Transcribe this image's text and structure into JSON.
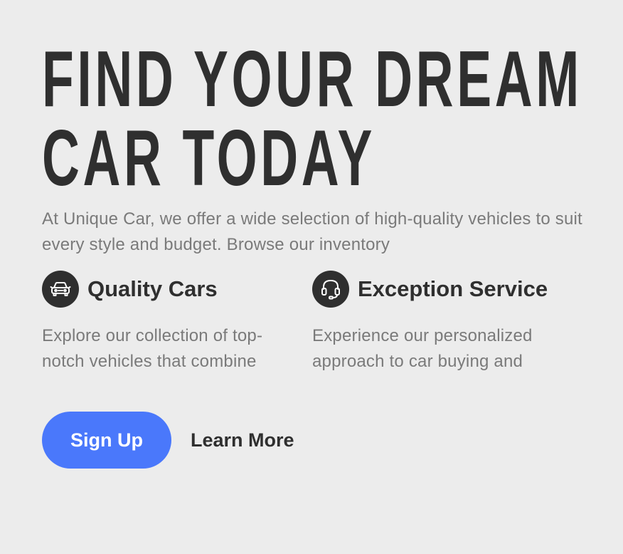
{
  "hero": {
    "headline_line1": "FIND YOUR DREAM",
    "headline_line2": "CAR TODAY",
    "intro": "At Unique Car, we offer a wide selection of high-quality vehicles to suit every style and budget. Browse our inventory"
  },
  "features": [
    {
      "icon": "car-icon",
      "title": "Quality Cars",
      "text": "Explore our collection of top-notch vehicles that combine"
    },
    {
      "icon": "headset-icon",
      "title": "Exception Service",
      "text": "Experience our personalized approach to car buying and"
    }
  ],
  "actions": {
    "primary_label": "Sign Up",
    "secondary_label": "Learn More"
  },
  "colors": {
    "background": "#ececec",
    "heading": "#2f2f2f",
    "body_text": "#7a7a7a",
    "accent": "#4a78fb"
  }
}
